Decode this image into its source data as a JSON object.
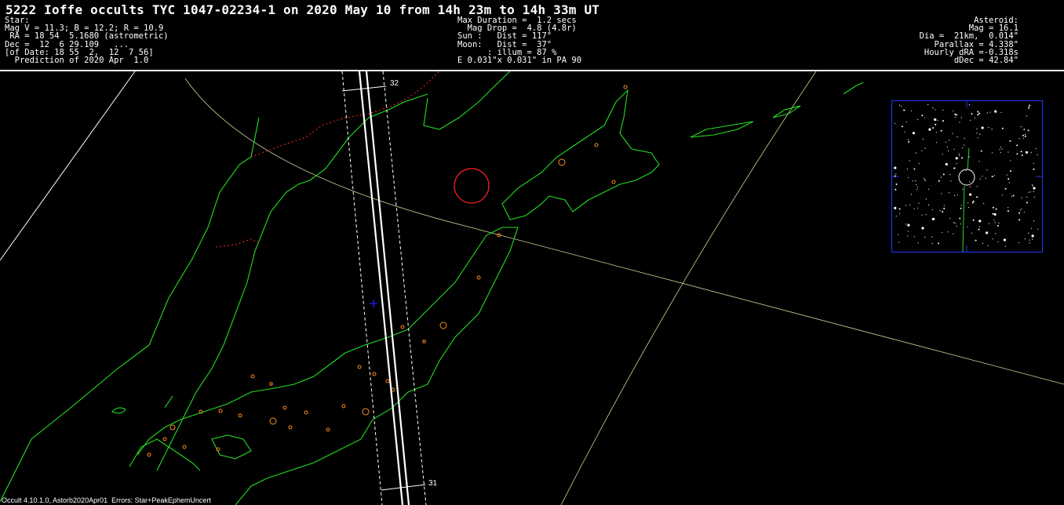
{
  "title": "5222 Ioffe occults TYC 1047-02234-1 on 2020 May 10 from 14h 23m to 14h 33m UT",
  "star_block": [
    "Star:",
    "Mag V = 11.3; B = 12.2; R = 10.9",
    " RA = 18 54  5.1680 (astrometric)",
    "Dec =  12  6 29.109   ...",
    "[of Date: 18 55  2,  12  7 56]",
    "  Prediction of 2020 Apr  1.0"
  ],
  "event_block": [
    "Max Duration =  1.2 secs",
    "  Mag Drop =  4.8 (4.8r)",
    "Sun :   Dist = 117°",
    "Moon:   Dist =  37°",
    "      : illum = 87 %",
    "E 0.031\"x 0.031\" in PA 90"
  ],
  "asteroid_block": [
    "Asteroid:",
    "Mag = 16.1",
    "Dia =  21km,  0.014\"",
    "Parallax = 4.338\"",
    "Hourly dRA =-0.318s",
    "dDec = 42.84\""
  ],
  "path_labels": {
    "top": "32",
    "bottom": "31"
  },
  "footer": "Occult 4.10.1.0, Astorb2020Apr01  Errors: Star+PeakEphemUncert",
  "colors": {
    "background": "#000000",
    "coastline": "#22dd22",
    "path": "#ffffff",
    "grid": "#c8d89a",
    "border_dotted": "#ff2a2a",
    "city": "#ff8c1a",
    "moon_marker": "#ff2020",
    "finder_frame": "#2336ff",
    "sub_star": "#2020ff"
  }
}
